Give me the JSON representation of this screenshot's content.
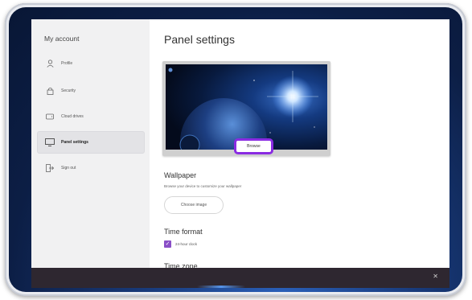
{
  "sidebar": {
    "title": "My account",
    "items": [
      {
        "label": "Profile",
        "icon": "person-icon"
      },
      {
        "label": "Security",
        "icon": "lock-icon"
      },
      {
        "label": "Cloud drives",
        "icon": "cloud-drive-icon"
      },
      {
        "label": "Panel settings",
        "icon": "monitor-icon",
        "active": true
      },
      {
        "label": "Sign out",
        "icon": "sign-out-icon"
      }
    ]
  },
  "main": {
    "title": "Panel settings",
    "preview": {
      "browse_label": "Browse"
    },
    "wallpaper": {
      "heading": "Wallpaper",
      "description": "Browse your device to customize your wallpaper",
      "choose_label": "Choose image"
    },
    "time_format": {
      "heading": "Time format",
      "checkbox_label": "24-hour clock",
      "checked": true
    },
    "next_section_heading": "Time zone"
  },
  "colors": {
    "accent": "#8a2be2",
    "checkbox": "#8a4fc7",
    "taskbar": "#2e2730",
    "sidebar_bg": "#f1f1f2"
  },
  "taskbar": {
    "close_icon": "close-icon"
  }
}
